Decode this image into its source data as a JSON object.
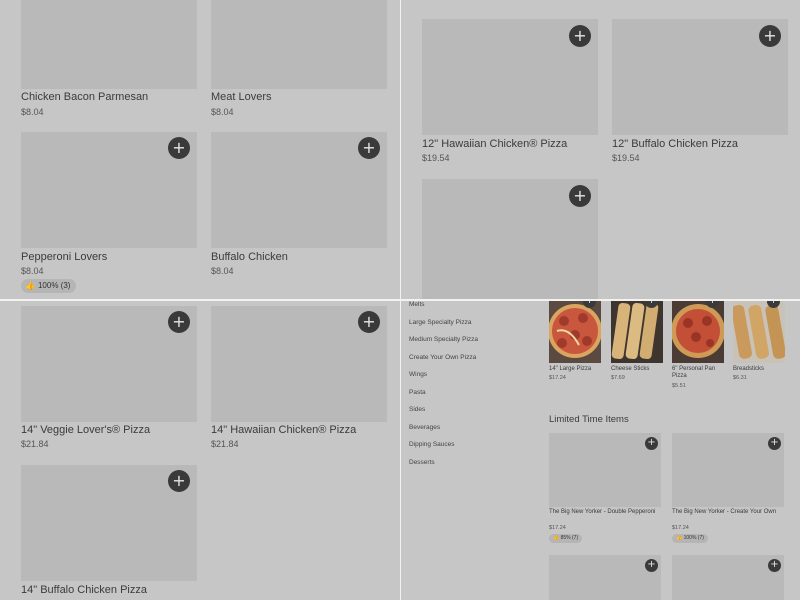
{
  "top_left": {
    "items": [
      {
        "name": "Chicken Bacon Parmesan",
        "price": "$8.04"
      },
      {
        "name": "Meat Lovers",
        "price": "$8.04"
      },
      {
        "name": "Pepperoni Lovers",
        "price": "$8.04",
        "rating": "100% (3)"
      },
      {
        "name": "Buffalo Chicken",
        "price": "$8.04"
      }
    ]
  },
  "top_right": {
    "items": [
      {
        "name": "12\" Hawaiian Chicken® Pizza",
        "price": "$19.54"
      },
      {
        "name": "12\" Buffalo Chicken Pizza",
        "price": "$19.54"
      },
      {
        "name": "",
        "price": ""
      }
    ]
  },
  "bottom_left": {
    "items": [
      {
        "name": "14\" Veggie Lover's® Pizza",
        "price": "$21.84"
      },
      {
        "name": "14\" Hawaiian Chicken® Pizza",
        "price": "$21.84"
      },
      {
        "name": "14\" Buffalo Chicken Pizza",
        "price": ""
      }
    ]
  },
  "bottom_right": {
    "categories": [
      "Melts",
      "Large Specialty Pizza",
      "Medium Specialty Pizza",
      "Create Your Own Pizza",
      "Wings",
      "Pasta",
      "Sides",
      "Beverages",
      "Dipping Sauces",
      "Desserts"
    ],
    "popular": [
      {
        "name": "14\" Large Pizza",
        "price": "$17.24",
        "image": "pizza"
      },
      {
        "name": "Cheese Sticks",
        "price": "$7.69",
        "image": "breadsticks"
      },
      {
        "name": "6\" Personal Pan Pizza",
        "price": "$5.51",
        "image": "pizza"
      },
      {
        "name": "Breadsticks",
        "price": "$6.31",
        "image": "breadsticks"
      }
    ],
    "limited_title": "Limited Time Items",
    "limited": [
      {
        "name": "The Big New Yorker - Double Pepperoni",
        "price": "$17.24",
        "rating": "85% (7)"
      },
      {
        "name": "The Big New Yorker - Create Your Own",
        "price": "$17.24",
        "rating": "100% (7)"
      }
    ]
  },
  "icons": {
    "add": "+",
    "thumbs_up": "👍"
  },
  "colors": {
    "add_button": "#3a3a3a",
    "placeholder": "#b9b9b9",
    "background": "#c6c6c6"
  }
}
